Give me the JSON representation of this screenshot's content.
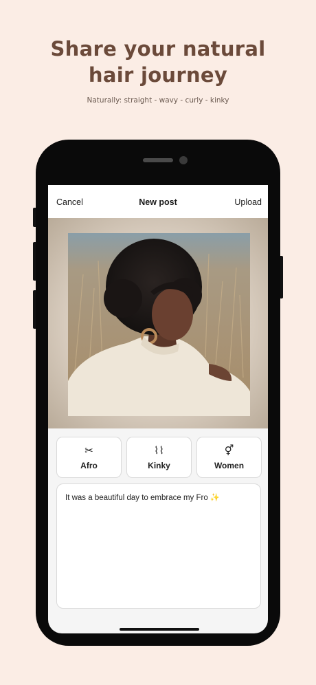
{
  "promo": {
    "headline_line1": "Share your natural",
    "headline_line2": "hair journey",
    "subline": "Naturally: straight - wavy - curly - kinky"
  },
  "navbar": {
    "cancel_label": "Cancel",
    "title": "New post",
    "upload_label": "Upload"
  },
  "tags": [
    {
      "label": "Afro",
      "icon": "scissors-icon",
      "glyph": "✂"
    },
    {
      "label": "Kinky",
      "icon": "hair-texture-icon",
      "glyph": "⌇⌇"
    },
    {
      "label": "Women",
      "icon": "gender-icon",
      "glyph": "⚥"
    }
  ],
  "caption": {
    "text": "It was a beautiful day to embrace my Fro ✨"
  },
  "colors": {
    "background": "#fbede5",
    "headline": "#6b4a3a",
    "phone": "#0a0a0a"
  }
}
